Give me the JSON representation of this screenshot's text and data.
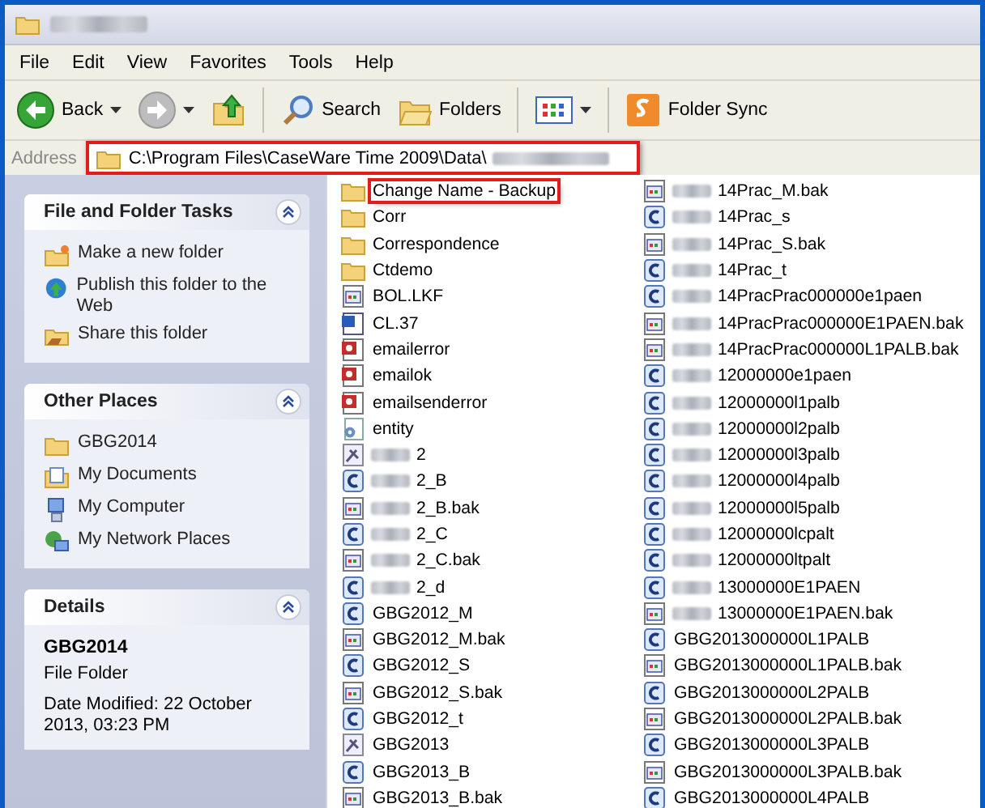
{
  "window": {
    "title_blurred": true
  },
  "menu": [
    "File",
    "Edit",
    "View",
    "Favorites",
    "Tools",
    "Help"
  ],
  "toolbar": [
    {
      "kind": "back",
      "label": "Back",
      "disabled": false
    },
    {
      "kind": "forward",
      "disabled": true
    },
    {
      "kind": "up"
    },
    {
      "kind": "separator"
    },
    {
      "kind": "search",
      "label": "Search"
    },
    {
      "kind": "folders",
      "label": "Folders"
    },
    {
      "kind": "separator"
    },
    {
      "kind": "views"
    },
    {
      "kind": "separator"
    },
    {
      "kind": "sync",
      "label": "Folder Sync"
    }
  ],
  "address": {
    "label": "Address",
    "path": "C:\\Program Files\\CaseWare Time 2009\\Data\\",
    "path_blurred": true,
    "highlighted": true
  },
  "sidebar": [
    {
      "title": "File and Folder Tasks",
      "expanded": true,
      "items": [
        {
          "kind": "newfolder",
          "label": "Make a new folder"
        },
        {
          "kind": "globe",
          "label": "Publish this folder to the Web"
        },
        {
          "kind": "share",
          "label": "Share this folder"
        }
      ]
    },
    {
      "title": "Other Places",
      "expanded": true,
      "items": [
        {
          "kind": "folder",
          "label": "GBG2014"
        },
        {
          "kind": "docs",
          "label": "My Documents"
        },
        {
          "kind": "computer",
          "label": "My Computer"
        },
        {
          "kind": "network",
          "label": "My Network Places"
        }
      ]
    },
    {
      "title": "Details",
      "expanded": true,
      "details": {
        "name": "GBG2014",
        "type": "File Folder",
        "modified": "Date Modified: 22 October 2013, 03:23 PM"
      }
    }
  ],
  "files": [
    {
      "kind": "folder",
      "name": "Change Name - Backup",
      "blurred": false,
      "highlighted": true
    },
    {
      "kind": "folder",
      "name": "Corr",
      "blurred": false,
      "highlighted": false
    },
    {
      "kind": "folder",
      "name": "Correspondence",
      "blurred": false,
      "highlighted": false
    },
    {
      "kind": "folder",
      "name": "Ctdemo",
      "blurred": false,
      "highlighted": false
    },
    {
      "kind": "app",
      "name": "BOL.LKF",
      "blurred": false,
      "highlighted": false
    },
    {
      "kind": "word",
      "name": "CL.37",
      "blurred": false,
      "highlighted": false
    },
    {
      "kind": "picture",
      "name": "emailerror",
      "blurred": false,
      "highlighted": false
    },
    {
      "kind": "picture",
      "name": "emailok",
      "blurred": false,
      "highlighted": false
    },
    {
      "kind": "picture",
      "name": "emailsenderror",
      "blurred": false,
      "highlighted": false
    },
    {
      "kind": "script",
      "name": "entity",
      "blurred": false,
      "highlighted": false
    },
    {
      "kind": "tool",
      "name": "2",
      "blurred": true,
      "highlighted": false
    },
    {
      "kind": "cfile",
      "name": "2_B",
      "blurred": true,
      "highlighted": false
    },
    {
      "kind": "app",
      "name": "2_B.bak",
      "blurred": true,
      "highlighted": false
    },
    {
      "kind": "cfile",
      "name": "2_C",
      "blurred": true,
      "highlighted": false
    },
    {
      "kind": "app",
      "name": "2_C.bak",
      "blurred": true,
      "highlighted": false
    },
    {
      "kind": "cfile",
      "name": "2_d",
      "blurred": true,
      "highlighted": false
    },
    {
      "kind": "cfile",
      "name": "GBG2012_M",
      "blurred": false,
      "highlighted": false
    },
    {
      "kind": "app",
      "name": "GBG2012_M.bak",
      "blurred": false,
      "highlighted": false
    },
    {
      "kind": "cfile",
      "name": "GBG2012_S",
      "blurred": false,
      "highlighted": false
    },
    {
      "kind": "app",
      "name": "GBG2012_S.bak",
      "blurred": false,
      "highlighted": false
    },
    {
      "kind": "cfile",
      "name": "GBG2012_t",
      "blurred": false,
      "highlighted": false
    },
    {
      "kind": "tool",
      "name": "GBG2013",
      "blurred": false,
      "highlighted": false
    },
    {
      "kind": "cfile",
      "name": "GBG2013_B",
      "blurred": false,
      "highlighted": false
    },
    {
      "kind": "app",
      "name": "GBG2013_B.bak",
      "blurred": false,
      "highlighted": false
    },
    {
      "kind": "app",
      "name": "14Prac_M.bak",
      "blurred": true,
      "highlighted": false
    },
    {
      "kind": "cfile",
      "name": "14Prac_s",
      "blurred": true,
      "highlighted": false
    },
    {
      "kind": "app",
      "name": "14Prac_S.bak",
      "blurred": true,
      "highlighted": false
    },
    {
      "kind": "cfile",
      "name": "14Prac_t",
      "blurred": true,
      "highlighted": false
    },
    {
      "kind": "cfile",
      "name": "14PracPrac000000e1paen",
      "blurred": true,
      "highlighted": false
    },
    {
      "kind": "app",
      "name": "14PracPrac000000E1PAEN.bak",
      "blurred": true,
      "highlighted": false
    },
    {
      "kind": "app",
      "name": "14PracPrac000000L1PALB.bak",
      "blurred": true,
      "highlighted": false
    },
    {
      "kind": "cfile",
      "name": "12000000e1paen",
      "blurred": true,
      "highlighted": false
    },
    {
      "kind": "cfile",
      "name": "12000000l1palb",
      "blurred": true,
      "highlighted": false
    },
    {
      "kind": "cfile",
      "name": "12000000l2palb",
      "blurred": true,
      "highlighted": false
    },
    {
      "kind": "cfile",
      "name": "12000000l3palb",
      "blurred": true,
      "highlighted": false
    },
    {
      "kind": "cfile",
      "name": "12000000l4palb",
      "blurred": true,
      "highlighted": false
    },
    {
      "kind": "cfile",
      "name": "12000000l5palb",
      "blurred": true,
      "highlighted": false
    },
    {
      "kind": "cfile",
      "name": "12000000lcpalt",
      "blurred": true,
      "highlighted": false
    },
    {
      "kind": "cfile",
      "name": "12000000ltpalt",
      "blurred": true,
      "highlighted": false
    },
    {
      "kind": "cfile",
      "name": "13000000E1PAEN",
      "blurred": true,
      "highlighted": false
    },
    {
      "kind": "app",
      "name": "13000000E1PAEN.bak",
      "blurred": true,
      "highlighted": false
    },
    {
      "kind": "cfile",
      "name": "GBG2013000000L1PALB",
      "blurred": false,
      "highlighted": false
    },
    {
      "kind": "app",
      "name": "GBG2013000000L1PALB.bak",
      "blurred": false,
      "highlighted": false
    },
    {
      "kind": "cfile",
      "name": "GBG2013000000L2PALB",
      "blurred": false,
      "highlighted": false
    },
    {
      "kind": "app",
      "name": "GBG2013000000L2PALB.bak",
      "blurred": false,
      "highlighted": false
    },
    {
      "kind": "cfile",
      "name": "GBG2013000000L3PALB",
      "blurred": false,
      "highlighted": false
    },
    {
      "kind": "app",
      "name": "GBG2013000000L3PALB.bak",
      "blurred": false,
      "highlighted": false
    },
    {
      "kind": "cfile",
      "name": "GBG2013000000L4PALB",
      "blurred": false,
      "highlighted": false
    }
  ]
}
